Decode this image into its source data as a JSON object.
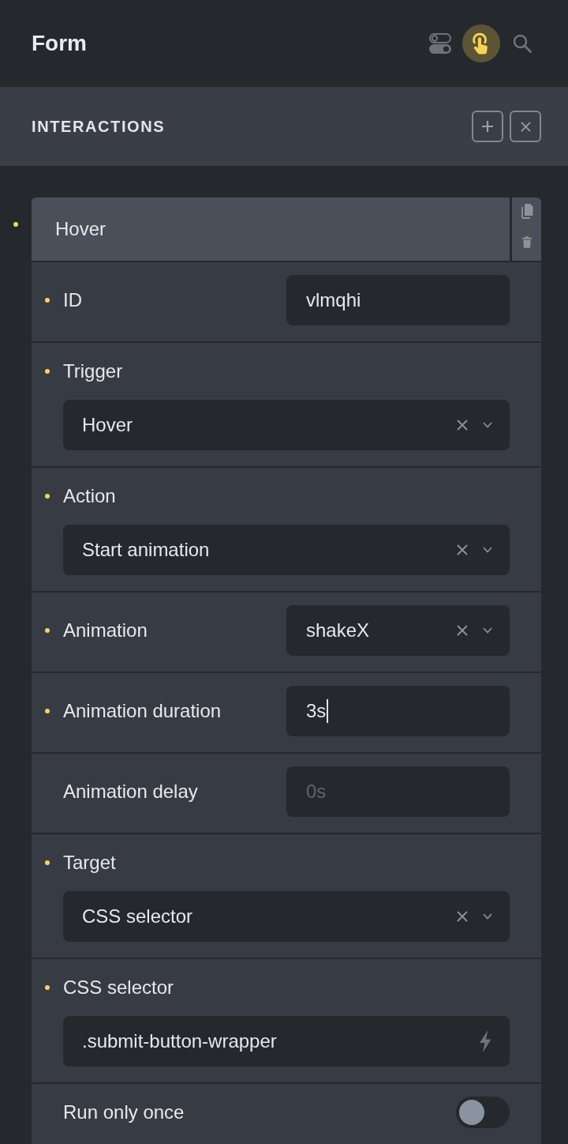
{
  "header": {
    "title": "Form",
    "tools": [
      {
        "kind": "toggles",
        "selected": false
      },
      {
        "kind": "interactions",
        "selected": true
      },
      {
        "kind": "search",
        "selected": false
      }
    ]
  },
  "section": {
    "title": "INTERACTIONS",
    "actions": [
      {
        "kind": "add"
      },
      {
        "kind": "close"
      }
    ]
  },
  "interaction": {
    "name": "Hover",
    "changed": true,
    "actions": [
      {
        "kind": "copy"
      },
      {
        "kind": "delete"
      }
    ],
    "fields": [
      {
        "label": "ID",
        "kind": "input",
        "value": "vlmqhi",
        "changed": true,
        "focused": false
      },
      {
        "label": "Trigger",
        "kind": "dropdown",
        "value": "Hover",
        "changed": true,
        "focused": false
      },
      {
        "label": "Action",
        "kind": "dropdown",
        "value": "Start animation",
        "changed": true,
        "focused": false
      },
      {
        "label": "Animation",
        "kind": "compact-dropdown",
        "value": "shakeX",
        "changed": true,
        "focused": false
      },
      {
        "label": "Animation duration",
        "kind": "input",
        "value": "3s",
        "changed": true,
        "focused": true
      },
      {
        "label": "Animation delay",
        "kind": "input",
        "placeholder": "0s",
        "changed": false,
        "focused": false
      },
      {
        "label": "Target",
        "kind": "dropdown",
        "value": "CSS selector",
        "changed": true,
        "focused": false
      },
      {
        "label": "CSS selector",
        "kind": "selector-input",
        "value": ".submit-button-wrapper",
        "changed": true,
        "focused": false
      },
      {
        "label": "Run only once",
        "kind": "toggle",
        "on": false,
        "changed": false
      }
    ]
  }
}
